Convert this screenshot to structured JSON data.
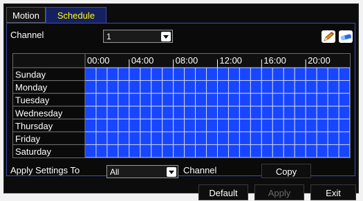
{
  "tabs": [
    {
      "label": "Motion",
      "active": false
    },
    {
      "label": "Schedule",
      "active": true
    }
  ],
  "channel": {
    "label": "Channel",
    "value": "1"
  },
  "tools": {
    "edit_icon": "pencil-icon",
    "erase_icon": "eraser-icon"
  },
  "schedule": {
    "time_labels": [
      "00:00",
      "04:00",
      "08:00",
      "12:00",
      "16:00",
      "20:00"
    ],
    "days": [
      "Sunday",
      "Monday",
      "Tuesday",
      "Wednesday",
      "Thursday",
      "Friday",
      "Saturday"
    ],
    "hours_per_day": 24,
    "fill_color": "#1846ff",
    "grid_line_color": "#c8d2ff",
    "all_hours_selected": true
  },
  "apply": {
    "label": "Apply Settings To",
    "value": "All",
    "suffix": "Channel",
    "copy_label": "Copy"
  },
  "footer": {
    "default_label": "Default",
    "apply_label": "Apply",
    "exit_label": "Exit"
  }
}
